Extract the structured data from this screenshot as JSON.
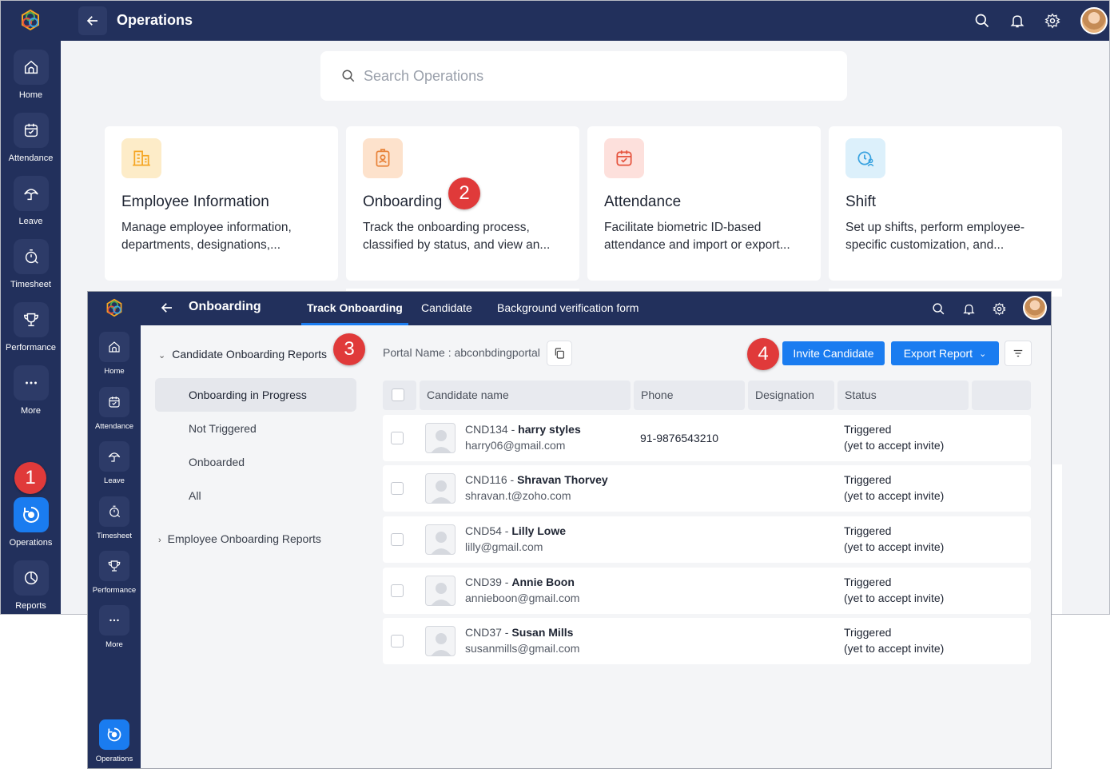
{
  "back_window": {
    "title": "Operations",
    "search_placeholder": "Search Operations",
    "sidebar": [
      {
        "label": "Home",
        "icon": "home-icon"
      },
      {
        "label": "Attendance",
        "icon": "calendar-check-icon"
      },
      {
        "label": "Leave",
        "icon": "umbrella-icon"
      },
      {
        "label": "Timesheet",
        "icon": "stopwatch-icon"
      },
      {
        "label": "Performance",
        "icon": "trophy-icon"
      },
      {
        "label": "More",
        "icon": "more-icon"
      },
      {
        "label": "Operations",
        "icon": "operations-icon",
        "active": true
      },
      {
        "label": "Reports",
        "icon": "pie-chart-icon"
      }
    ],
    "cards": [
      {
        "title": "Employee Information",
        "desc": "Manage employee information, departments, designations,...",
        "icon": "building-icon",
        "color": "#f5a623"
      },
      {
        "title": "Onboarding",
        "desc": "Track the onboarding process, classified by status, and view an...",
        "icon": "id-badge-icon",
        "color": "#e8833a"
      },
      {
        "title": "Attendance",
        "desc": "Facilitate biometric ID-based attendance and import or export...",
        "icon": "calendar-check-icon",
        "color": "#e5533d"
      },
      {
        "title": "Shift",
        "desc": "Set up shifts, perform employee-specific customization, and...",
        "icon": "shift-clock-icon",
        "color": "#3aa3e0"
      }
    ]
  },
  "front_window": {
    "title": "Onboarding",
    "tabs": [
      "Track Onboarding",
      "Candidate",
      "Background verification form"
    ],
    "sidebar": [
      {
        "label": "Home"
      },
      {
        "label": "Attendance"
      },
      {
        "label": "Leave"
      },
      {
        "label": "Timesheet"
      },
      {
        "label": "Performance"
      },
      {
        "label": "More"
      },
      {
        "label": "Operations",
        "active": true
      }
    ],
    "tree": {
      "group1": "Candidate Onboarding Reports",
      "items": [
        "Onboarding in Progress",
        "Not Triggered",
        "Onboarded",
        "All"
      ],
      "group2": "Employee Onboarding Reports"
    },
    "portal_name": "Portal Name : abconbdingportal",
    "invite_label": "Invite Candidate",
    "export_label": "Export Report",
    "columns": [
      "Candidate name",
      "Phone",
      "Designation",
      "Status"
    ],
    "rows": [
      {
        "id": "CND134 - ",
        "name": "harry styles",
        "email": "harry06@gmail.com",
        "phone": "91-9876543210",
        "status": "Triggered",
        "status_note": "(yet to accept invite)"
      },
      {
        "id": "CND116 - ",
        "name": "Shravan Thorvey",
        "email": "shravan.t@zoho.com",
        "phone": "",
        "status": "Triggered",
        "status_note": "(yet to accept invite)"
      },
      {
        "id": "CND54 - ",
        "name": "Lilly Lowe",
        "email": "lilly@gmail.com",
        "phone": "",
        "status": "Triggered",
        "status_note": "(yet to accept invite)"
      },
      {
        "id": "CND39 - ",
        "name": "Annie Boon",
        "email": "annieboon@gmail.com",
        "phone": "",
        "status": "Triggered",
        "status_note": "(yet to accept invite)"
      },
      {
        "id": "CND37 - ",
        "name": "Susan Mills",
        "email": "susanmills@gmail.com",
        "phone": "",
        "status": "Triggered",
        "status_note": "(yet to accept invite)"
      }
    ]
  },
  "callouts": [
    "1",
    "2",
    "3",
    "4"
  ],
  "colors": {
    "nav_bg": "#22305c",
    "accent": "#1a7cf0",
    "callout": "#e03a3a"
  }
}
